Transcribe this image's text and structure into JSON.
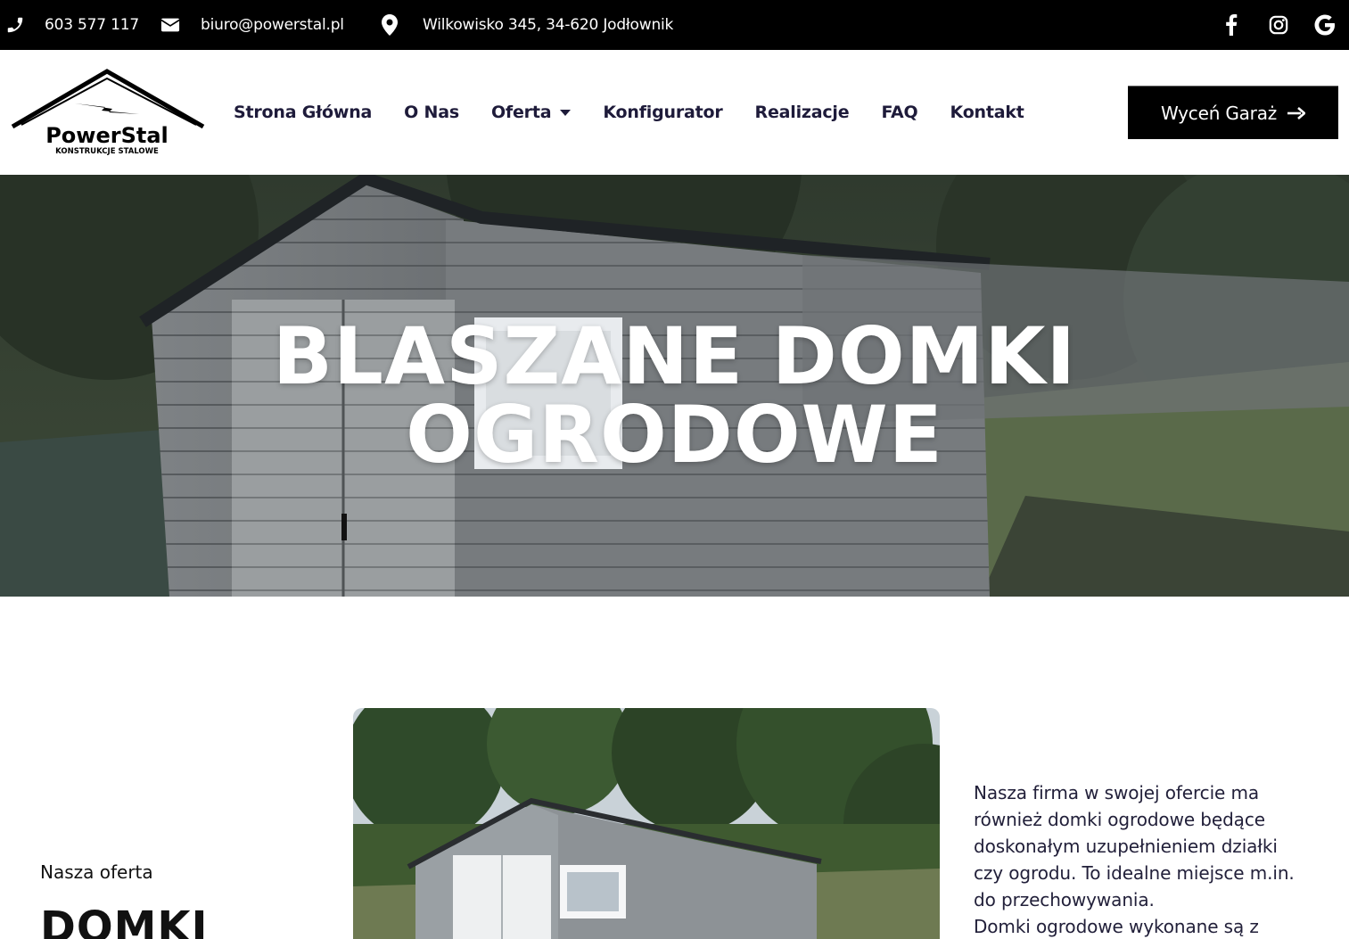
{
  "topbar": {
    "phone": "603 577 117",
    "email": "biuro@powerstal.pl",
    "address": "Wilkowisko 345, 34-620 Jodłownik",
    "icons": [
      "phone-icon",
      "envelope-icon",
      "map-marker-icon"
    ],
    "social": [
      "facebook-icon",
      "instagram-icon",
      "google-icon"
    ]
  },
  "logo": {
    "name": "PowerStal",
    "tagline": "KONSTRUKCJE STALOWE"
  },
  "nav": {
    "items": [
      {
        "label": "Strona Główna"
      },
      {
        "label": "O Nas"
      },
      {
        "label": "Oferta",
        "dropdown": true
      },
      {
        "label": "Konfigurator"
      },
      {
        "label": "Realizacje"
      },
      {
        "label": "FAQ"
      },
      {
        "label": "Kontakt"
      }
    ],
    "cta_label": "Wyceń Garaż"
  },
  "hero": {
    "title_line1": "BLASZANE DOMKI",
    "title_line2": "OGRODOWE"
  },
  "content": {
    "label": "Nasza oferta",
    "heading": "DOMKI",
    "description": "Nasza firma w swojej ofercie ma również domki ogrodowe będące doskonałym uzupełnieniem działki czy ogrodu. To idealne miejsce m.in. do przechowywania.",
    "description_2": "Domki ogrodowe wykonane są z"
  },
  "colors": {
    "topbar_bg": "#000000",
    "nav_text": "#1e1b3a",
    "cta_bg": "#000000",
    "body_text": "#22203a"
  }
}
